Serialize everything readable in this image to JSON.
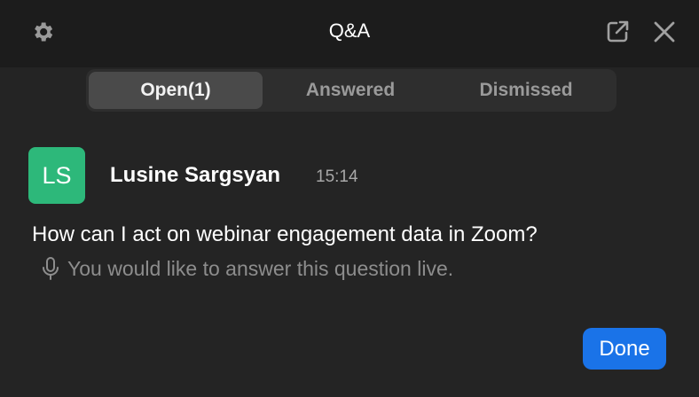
{
  "header": {
    "title": "Q&A",
    "icons": [
      "gear-icon",
      "popout-icon",
      "close-icon"
    ]
  },
  "tabs": [
    {
      "label": "Open(1)",
      "active": true
    },
    {
      "label": "Answered",
      "active": false
    },
    {
      "label": "Dismissed",
      "active": false
    }
  ],
  "question": {
    "avatar_initials": "LS",
    "avatar_color": "#2db87a",
    "author": "Lusine Sargsyan",
    "time": "15:14",
    "text": "How can I act on webinar engagement data in Zoom?",
    "live_note": "You would like to answer this question live.",
    "live_icon": "microphone-icon"
  },
  "actions": {
    "done_label": "Done"
  },
  "colors": {
    "background": "#242424",
    "accent": "#1a73e8"
  }
}
